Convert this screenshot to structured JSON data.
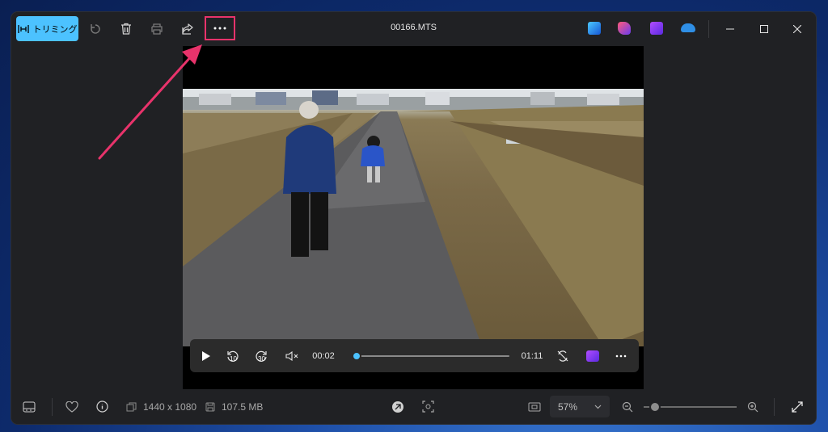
{
  "titlebar": {
    "trim_label": "トリミング",
    "file_name": "00166.MTS",
    "icons": [
      "trim-icon",
      "rotate-icon",
      "delete-icon",
      "print-icon",
      "share-icon",
      "more-icon"
    ],
    "apps": [
      "photoshop-express-icon",
      "clipchamp-icon",
      "video-editor-icon",
      "onedrive-icon"
    ]
  },
  "player": {
    "current_time": "00:02",
    "total_time": "01:11",
    "progress": 0.03,
    "skip_back": "10",
    "skip_forward": "30"
  },
  "bottombar": {
    "resolution": "1440 x 1080",
    "file_size": "107.5 MB",
    "zoom_level": "57%",
    "zoom_value": 0.12
  },
  "colors": {
    "accent": "#4cc2ff",
    "highlight": "#e8336b",
    "window_bg": "#202124"
  }
}
